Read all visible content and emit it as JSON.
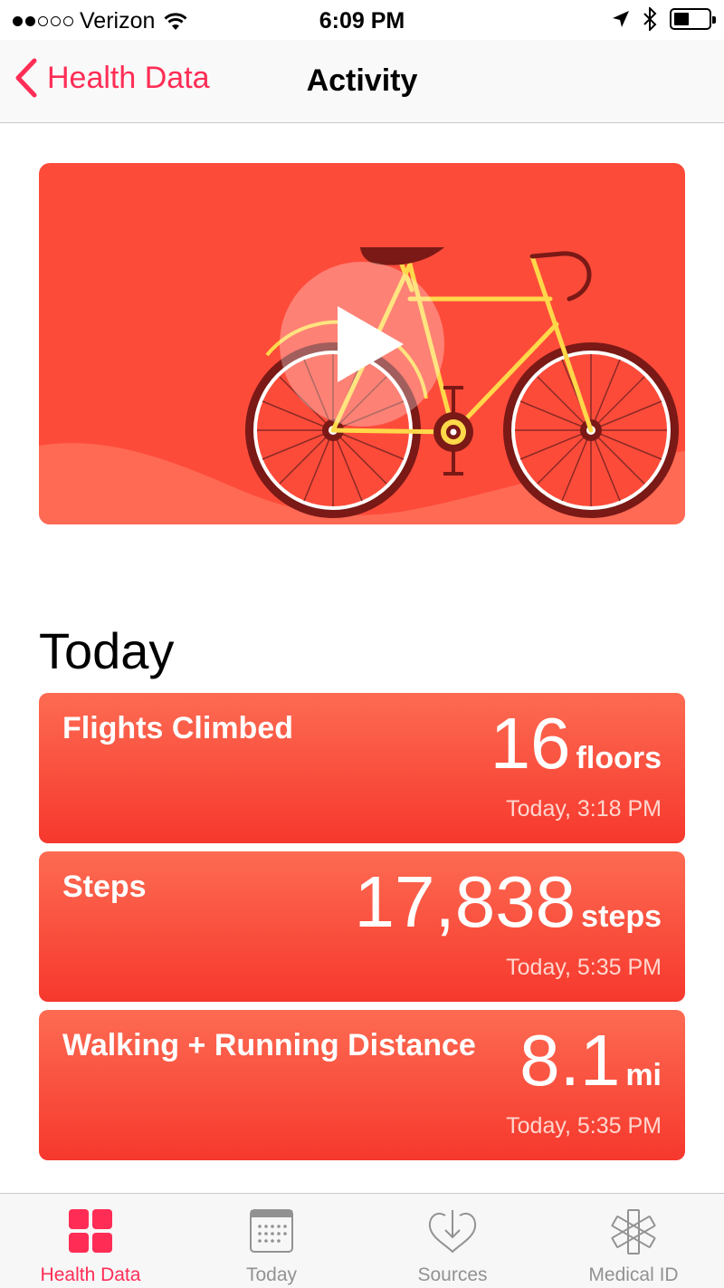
{
  "status_bar": {
    "carrier": "Verizon",
    "time": "6:09 PM",
    "signal_bars_filled": 2,
    "signal_bars_total": 5,
    "battery_level": 0.45
  },
  "nav": {
    "back_label": "Health Data",
    "title": "Activity",
    "accent_color": "#ff2d55"
  },
  "video": {
    "play_icon": "play-icon",
    "illustration": "bicycle",
    "background_color": "#fd4b3a"
  },
  "today": {
    "title": "Today",
    "cards": [
      {
        "label": "Flights Climbed",
        "value": "16",
        "unit": "floors",
        "time": "Today, 3:18 PM"
      },
      {
        "label": "Steps",
        "value": "17,838",
        "unit": "steps",
        "time": "Today, 5:35 PM"
      },
      {
        "label": "Walking + Running Distance",
        "value": "8.1",
        "unit": "mi",
        "time": "Today, 5:35 PM"
      }
    ]
  },
  "tab_bar": {
    "tabs": [
      {
        "label": "Health Data",
        "icon": "grid-icon",
        "active": true
      },
      {
        "label": "Today",
        "icon": "calendar-icon",
        "active": false
      },
      {
        "label": "Sources",
        "icon": "heart-download-icon",
        "active": false
      },
      {
        "label": "Medical ID",
        "icon": "star-of-life-icon",
        "active": false
      }
    ]
  }
}
